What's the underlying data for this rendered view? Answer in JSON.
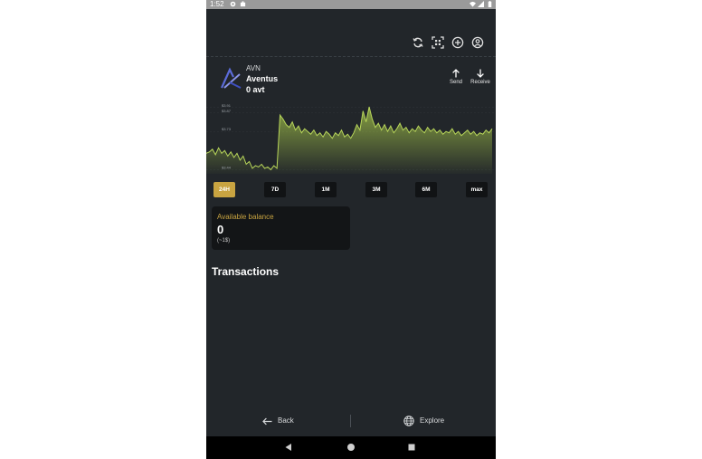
{
  "status_bar": {
    "time": "1:52"
  },
  "asset": {
    "symbol": "AVN",
    "name": "Aventus",
    "balance": "0 avt"
  },
  "actions": {
    "send": "Send",
    "receive": "Receive"
  },
  "chart_data": {
    "type": "line",
    "ytick_labels": [
      "$3.91",
      "$3.87",
      "$3.73",
      "$3.44"
    ],
    "line_color": "#b8d65a",
    "series": [
      {
        "values": [
          3.57,
          3.58,
          3.6,
          3.56,
          3.61,
          3.57,
          3.59,
          3.55,
          3.58,
          3.54,
          3.57,
          3.52,
          3.55,
          3.49,
          3.51,
          3.46,
          3.48,
          3.47,
          3.49,
          3.46,
          3.47,
          3.45,
          3.48,
          3.46,
          3.85,
          3.82,
          3.78,
          3.76,
          3.8,
          3.74,
          3.77,
          3.72,
          3.75,
          3.73,
          3.71,
          3.74,
          3.7,
          3.72,
          3.69,
          3.73,
          3.71,
          3.68,
          3.72,
          3.7,
          3.74,
          3.69,
          3.71,
          3.68,
          3.72,
          3.78,
          3.74,
          3.88,
          3.8,
          3.91,
          3.82,
          3.76,
          3.79,
          3.74,
          3.78,
          3.73,
          3.77,
          3.72,
          3.75,
          3.79,
          3.74,
          3.76,
          3.72,
          3.75,
          3.73,
          3.77,
          3.74,
          3.72,
          3.76,
          3.73,
          3.75,
          3.72,
          3.74,
          3.71,
          3.73,
          3.72,
          3.75,
          3.71,
          3.73,
          3.7,
          3.72,
          3.74,
          3.71,
          3.73,
          3.7,
          3.72,
          3.71,
          3.74,
          3.72,
          3.75
        ]
      }
    ]
  },
  "time_ranges": [
    {
      "label": "24H",
      "active": true
    },
    {
      "label": "7D",
      "active": false
    },
    {
      "label": "1M",
      "active": false
    },
    {
      "label": "3M",
      "active": false
    },
    {
      "label": "6M",
      "active": false
    },
    {
      "label": "max",
      "active": false
    }
  ],
  "balance_card": {
    "label": "Available balance",
    "value": "0",
    "fiat": "(~1$)"
  },
  "transactions": {
    "title": "Transactions"
  },
  "bottom_bar": {
    "back": "Back",
    "explore": "Explore"
  },
  "colors": {
    "background": "#22262a",
    "accent": "#c9a441",
    "card": "#131517"
  },
  "icons": [
    "refresh-icon",
    "qr-scan-icon",
    "add-circle-icon",
    "account-icon",
    "arrow-up-icon",
    "arrow-down-icon",
    "arrow-left-icon",
    "globe-icon"
  ]
}
